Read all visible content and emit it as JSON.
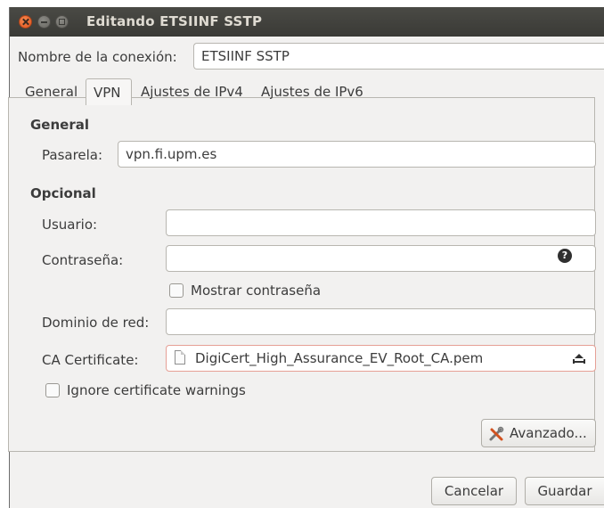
{
  "window": {
    "title": "Editando ETSIINF SSTP"
  },
  "connection": {
    "label": "Nombre de la conexión:",
    "value": "ETSIINF SSTP"
  },
  "tabs": [
    {
      "label": "General"
    },
    {
      "label": "VPN",
      "active": true
    },
    {
      "label": "Ajustes de IPv4"
    },
    {
      "label": "Ajustes de IPv6"
    }
  ],
  "vpn": {
    "general_heading": "General",
    "gateway": {
      "label": "Pasarela:",
      "value": "vpn.fi.upm.es"
    },
    "optional_heading": "Opcional",
    "user": {
      "label": "Usuario:",
      "value": ""
    },
    "password": {
      "label": "Contraseña:",
      "value": "",
      "icon": "password-mode-icon"
    },
    "show_password": {
      "label": "Mostrar contraseña",
      "checked": false
    },
    "domain": {
      "label": "Dominio de red:",
      "value": ""
    },
    "ca_certificate": {
      "label": "CA Certificate:",
      "value": "DigiCert_High_Assurance_EV_Root_CA.pem",
      "icon": "document-icon"
    },
    "ignore_warnings": {
      "label": "Ignore certificate warnings",
      "checked": false
    },
    "advanced_button": {
      "label": "Avanzado...",
      "icon": "tools-icon"
    }
  },
  "actions": {
    "cancel": "Cancelar",
    "save": "Guardar"
  },
  "colors": {
    "titlebar": "#3c3b37",
    "close_button": "#e95420",
    "window_bg": "#f2f1f0"
  }
}
